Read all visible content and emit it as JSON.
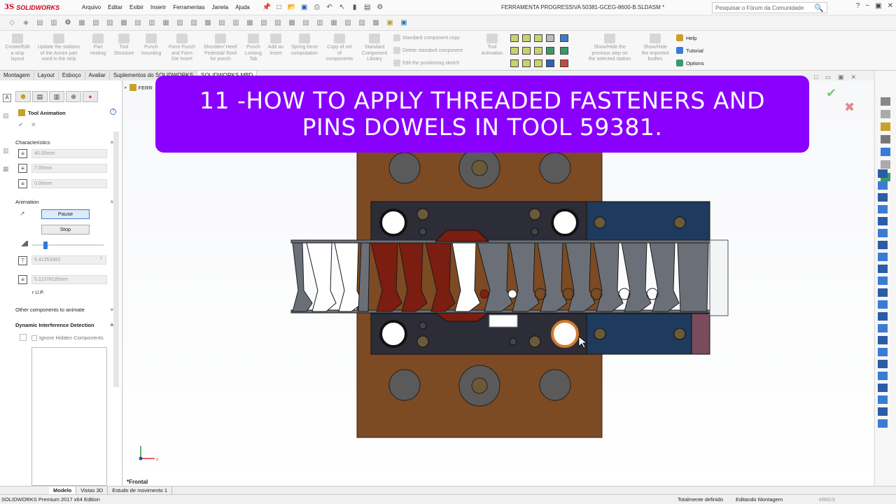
{
  "app": {
    "brand": "SOLIDWORKS",
    "brand_prefix": "3S",
    "menus": [
      "Arquivo",
      "Editar",
      "Exibir",
      "Inserir",
      "Ferramentas",
      "Janela",
      "Ajuda"
    ],
    "document_title": "FERRAMENTA PROGRESSIVA 50381-GCEG-8600-B.SLDASM *",
    "search_placeholder": "Pesquisar o Fórum da Comunidade"
  },
  "ribbon": {
    "buttons": [
      {
        "label": "Create/Edit\na strip\nlayout"
      },
      {
        "label": "Update the stations\nof the Annex part\nused in the strip"
      },
      {
        "label": "Part\nnesting"
      },
      {
        "label": "Tool\nStructure"
      },
      {
        "label": "Punch\nmounting"
      },
      {
        "label": "Form Punch\nand Form\nDie Insert"
      },
      {
        "label": "Shoulder/ Heel/\nPedestal/ Roof\nfor punch"
      },
      {
        "label": "Punch\nLocking\nTab"
      },
      {
        "label": "Add an\ninsert"
      },
      {
        "label": "Spring force\ncomputation"
      },
      {
        "label": "Copy of set\nof\ncomponents"
      },
      {
        "label": "Standard\nComponent\nLibrary"
      },
      {
        "label": "Tool\nAnimation"
      },
      {
        "label": "Show/Hide the\nprevious step on\nthe selected station"
      },
      {
        "label": "Show/Hide\nthe imported\nbodies"
      }
    ],
    "small": [
      "Standard component copy",
      "Delete standard component",
      "Edit the positioning sketch"
    ],
    "links": [
      "Help",
      "Tutorial",
      "Options"
    ]
  },
  "tabs": [
    "Montagem",
    "Layout",
    "Esboço",
    "Avaliar",
    "Suplementos do SOLIDWORKS",
    "SOLIDWORKS MBD"
  ],
  "property_manager": {
    "title": "Tool Animation",
    "characteristics": {
      "heading": "Characteristics",
      "fields": [
        "40.00mm",
        "7.00mm",
        "0.00mm"
      ]
    },
    "animation": {
      "heading": "Animation",
      "pause": "Pause",
      "stop": "Stop",
      "speed": 0.18,
      "value1": "5.41353383",
      "value2": "5.11278195mm",
      "unit": "r U.P."
    },
    "other_components": "Other components to animate",
    "interference": {
      "heading": "Dynamic Interference Detection",
      "checkbox": "Ignore Hidden Components"
    }
  },
  "tree": {
    "item": "FERR"
  },
  "view_name": "*Frontal",
  "bottom_tabs": [
    "Modelo",
    "Vistas 3D",
    "Estudo de movimento 1"
  ],
  "status": {
    "edition": "SOLIDWORKS Premium 2017 x64 Edition",
    "defined": "Totalmente definido",
    "editing": "Editando Montagem",
    "units": "MMGS"
  },
  "banner": {
    "line1": "11 -HOW TO APPLY THREADED FASTENERS AND",
    "line2": "PINS DOWELS IN TOOL 59381."
  },
  "colors": {
    "banner": "#8a00ff",
    "die_plate": "#7c4a23",
    "punch_plate": "#2d2d38",
    "strip": "#6b7078",
    "red_part": "#7b1d10",
    "blue_plate": "#1e3a5c"
  }
}
